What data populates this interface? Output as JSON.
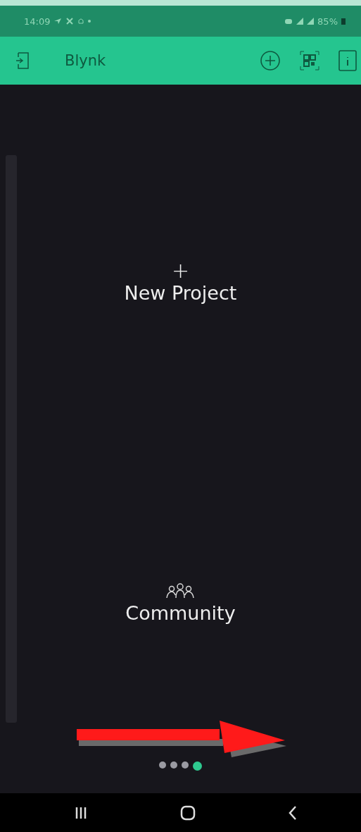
{
  "status_bar": {
    "time": "14:09",
    "battery": "85%"
  },
  "app_bar": {
    "title": "Blynk"
  },
  "new_project": {
    "icon": "+",
    "label": "New Project"
  },
  "community": {
    "label": "Community"
  },
  "page_dots": [
    {
      "selected": false
    },
    {
      "selected": false
    },
    {
      "selected": false
    },
    {
      "selected": true
    }
  ]
}
